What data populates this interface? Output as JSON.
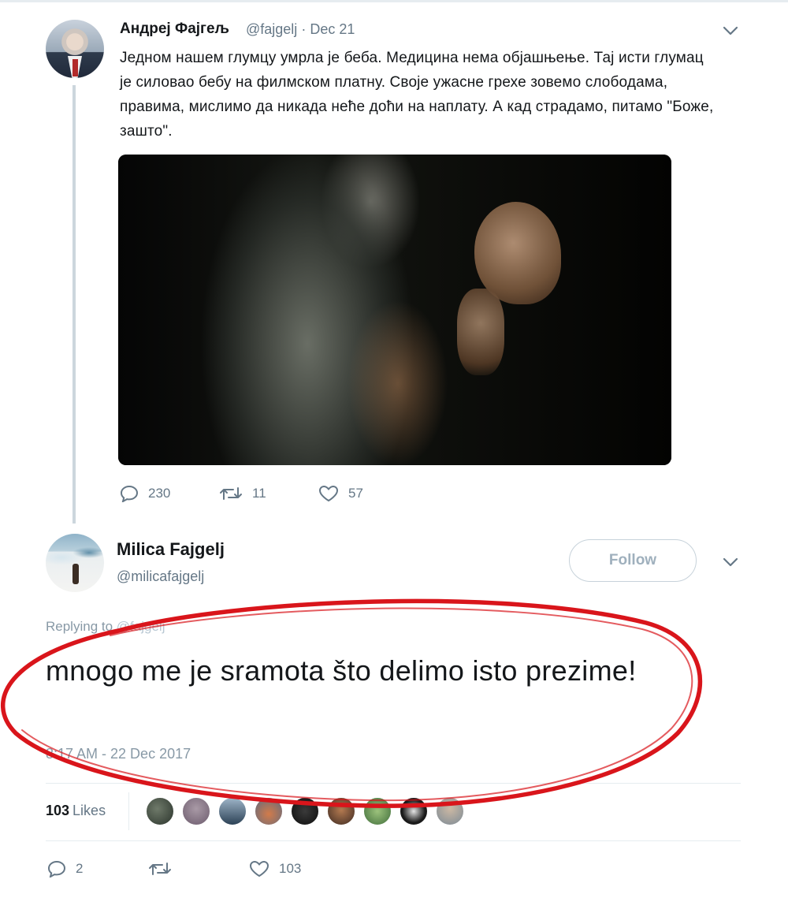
{
  "parent_tweet": {
    "author_name": "Андреј Фајгељ",
    "author_handle": "@fajgelj",
    "separator": "·",
    "date": "Dec 21",
    "text": "Једном нашем глумцу умрла је беба. Медицина нема објашњење. Тај исти глумац је силовао бебу на филмском платну. Своје ужасне грехе зовемо слободама, правима, мислимо да никада неће доћи на наплату. А кад страдамо, питамо \"Боже, зашто\".",
    "replies": "230",
    "retweets": "11",
    "likes": "57"
  },
  "main_tweet": {
    "author_name": "Milica Fajgelj",
    "author_handle": "@milicafajgelj",
    "follow_label": "Follow",
    "replying_prefix": "Replying to",
    "replying_handle": "@fajgelj",
    "text": "mnogo me je sramota što delimo isto prezime!",
    "timestamp": "8:17 AM - 22 Dec 2017",
    "likes_count": "103",
    "likes_label": "Likes",
    "reply_count": "2",
    "retweet_count": "",
    "like_count": "103"
  },
  "icons": {
    "reply": "reply-icon",
    "retweet": "retweet-icon",
    "like": "heart-icon",
    "menu": "chevron-down-icon"
  },
  "colors": {
    "text": "#14171a",
    "muted": "#657786",
    "border": "#e6ecf0",
    "annotation": "#d9151b"
  }
}
